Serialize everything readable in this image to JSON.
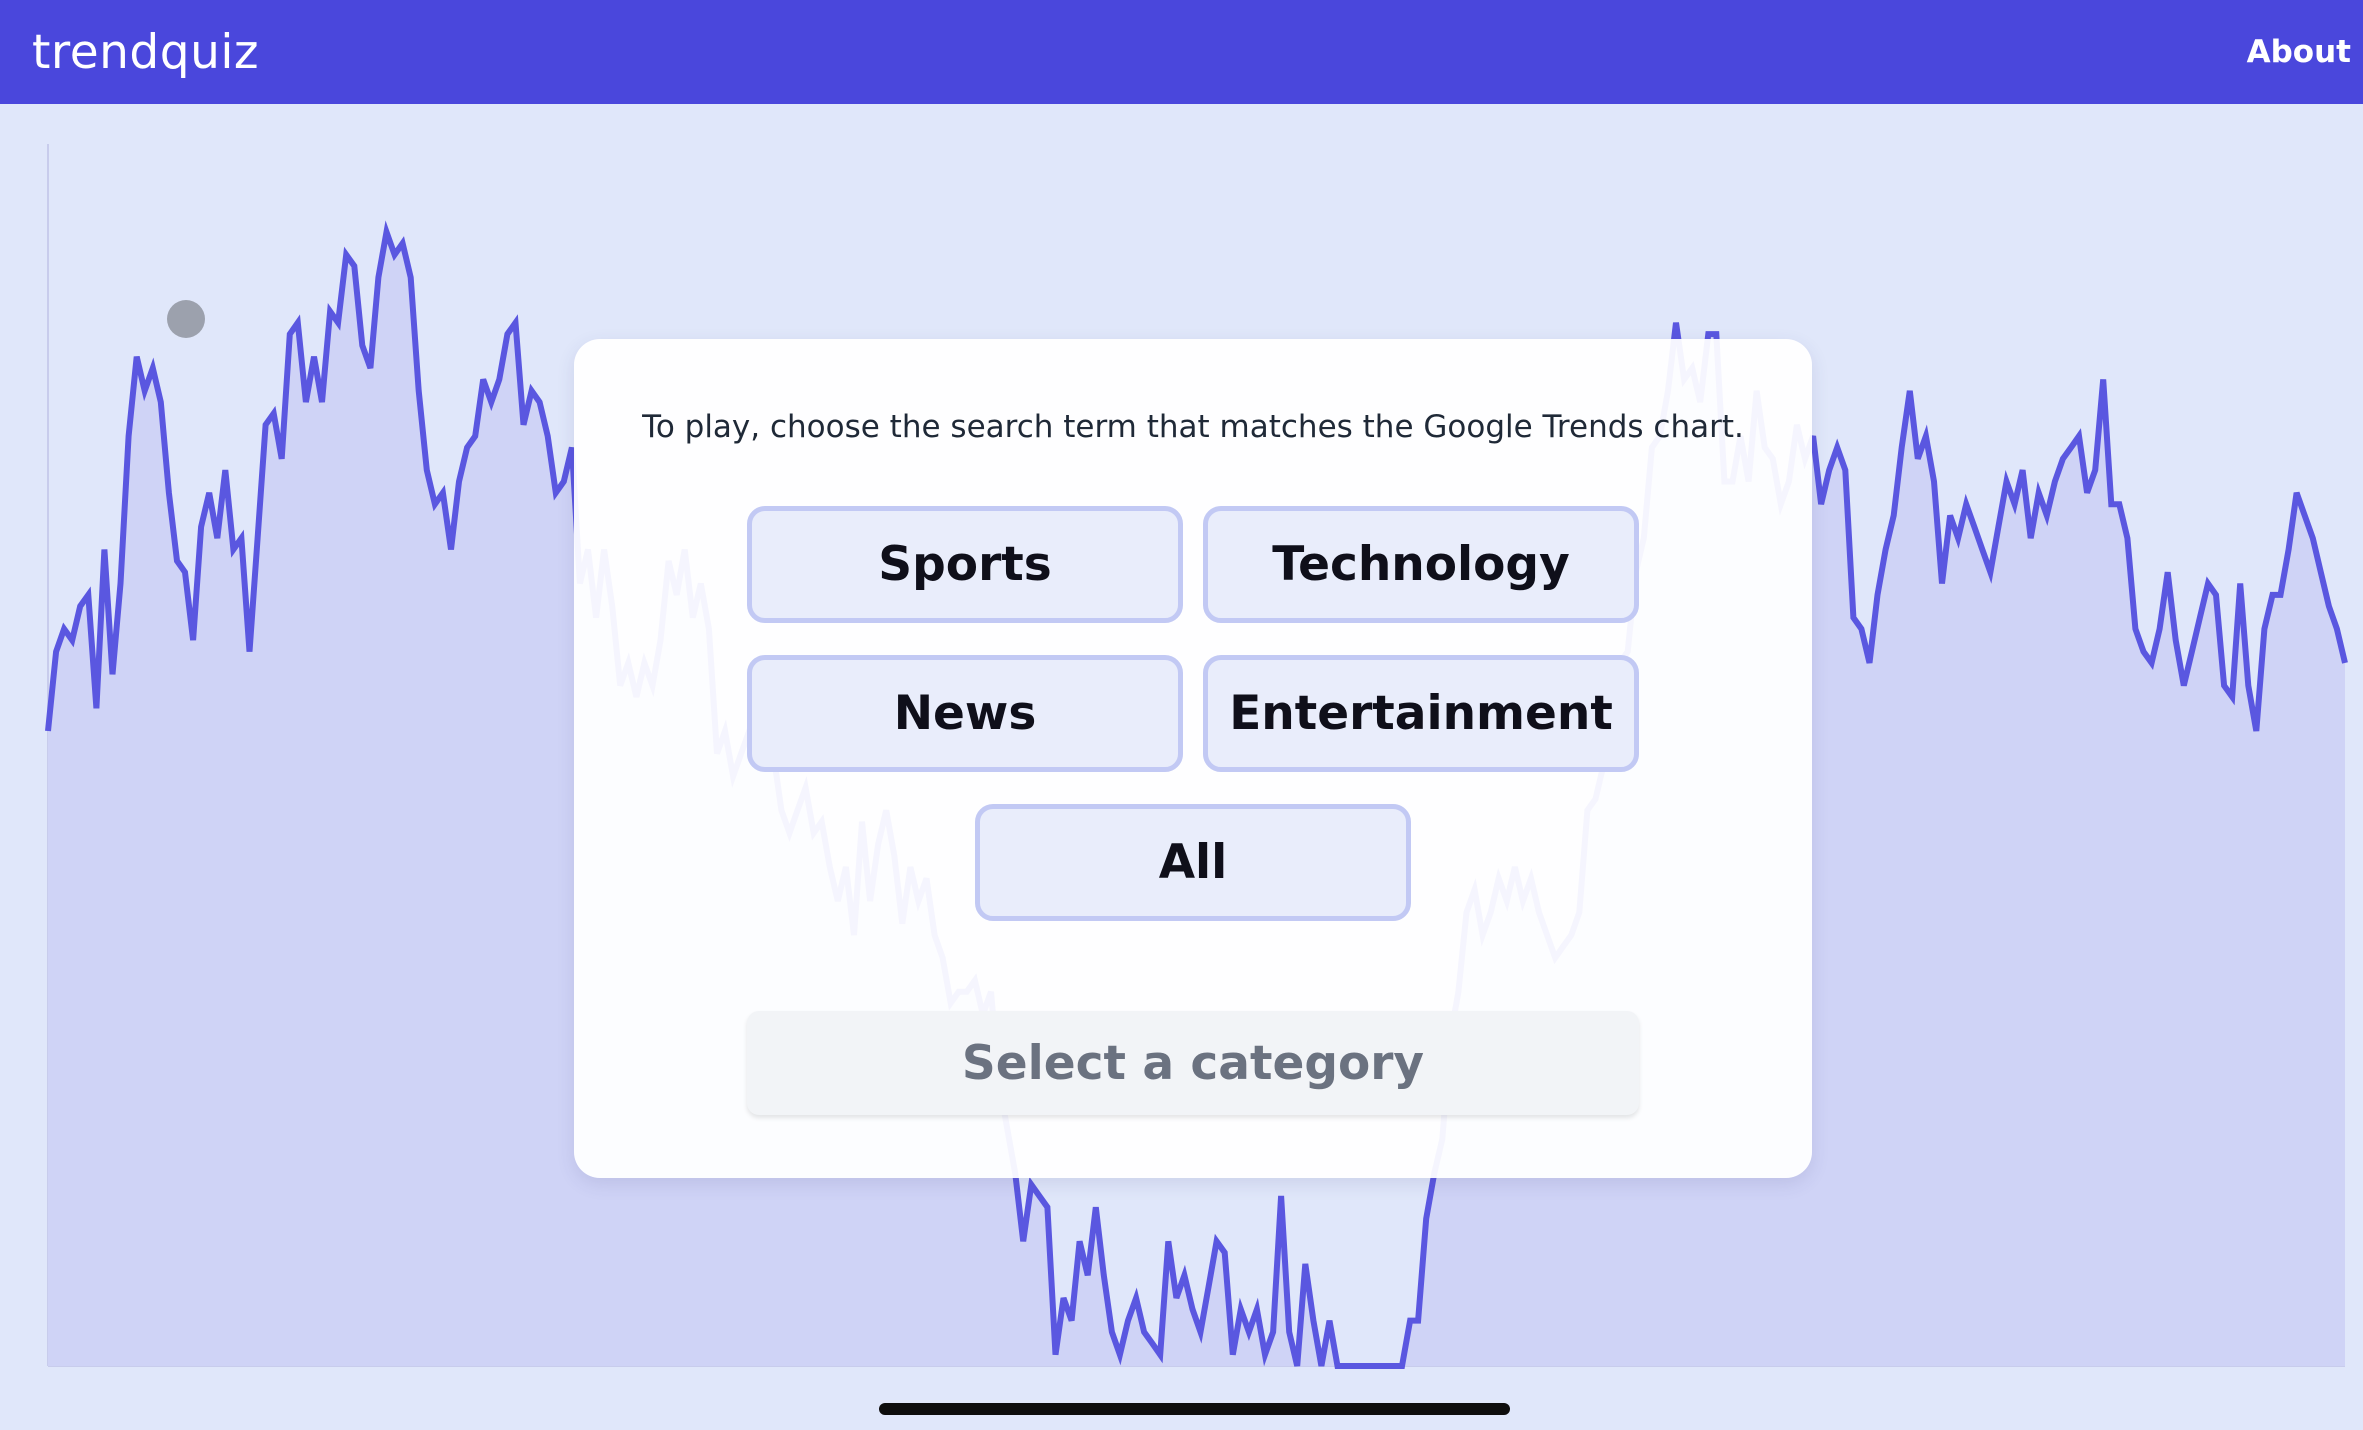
{
  "navbar": {
    "brand": "trendquiz",
    "about_label": "About"
  },
  "colors": {
    "nav_bg": "#4a47dc",
    "page_bg": "#e0e7fa",
    "line": "#5a57e0",
    "area_fill": "#cfd3f6",
    "button_bg": "#e9edfb",
    "button_border": "#c2c9f4",
    "submit_bg": "#f2f4f7",
    "submit_text": "#6b7280"
  },
  "quiz": {
    "instructions": "To play, choose the search term that matches the Google Trends chart.",
    "categories": [
      "Sports",
      "Technology",
      "News",
      "Entertainment",
      "All"
    ],
    "submit_label": "Select a category"
  },
  "chart_data": {
    "type": "area",
    "y": [
      56,
      63,
      65,
      64,
      67,
      68,
      58,
      72,
      61,
      69,
      82,
      89,
      86,
      88,
      85,
      77,
      71,
      70,
      64,
      74,
      77,
      73,
      79,
      72,
      73,
      63,
      73,
      83,
      84,
      80,
      91,
      92,
      85,
      89,
      85,
      93,
      92,
      98,
      97,
      90,
      88,
      96,
      100,
      98,
      99,
      96,
      86,
      79,
      76,
      77,
      72,
      78,
      81,
      82,
      87,
      85,
      87,
      91,
      92,
      83,
      86,
      85,
      82,
      77,
      78,
      81,
      69,
      72,
      66,
      72,
      67,
      60,
      62,
      59,
      62,
      60,
      64,
      71,
      68,
      72,
      66,
      69,
      65,
      54,
      56,
      52,
      54,
      56,
      55,
      54,
      54,
      49,
      47,
      49,
      51,
      47,
      48,
      44,
      41,
      44,
      38,
      48,
      41,
      46,
      49,
      45,
      39,
      44,
      41,
      43,
      38,
      36,
      32,
      33,
      33,
      34,
      31,
      33,
      25,
      21,
      17,
      11,
      16,
      15,
      14,
      1,
      6,
      4,
      11,
      8,
      14,
      8,
      3,
      1,
      4,
      6,
      3,
      2,
      1,
      11,
      6,
      8,
      5,
      3,
      7,
      11,
      10,
      1,
      5,
      3,
      5,
      1,
      3,
      15,
      3,
      0,
      9,
      4,
      0,
      4,
      0,
      0,
      0,
      0,
      0,
      0,
      0,
      0,
      0,
      4,
      4,
      13,
      17,
      20,
      29,
      33,
      40,
      42,
      38,
      40,
      43,
      41,
      44,
      41,
      43,
      40,
      38,
      36,
      37,
      38,
      40,
      49,
      50,
      53,
      58,
      62,
      63,
      70,
      73,
      81,
      82,
      86,
      92,
      87,
      88,
      85,
      91,
      91,
      78,
      78,
      82,
      78,
      86,
      81,
      80,
      76,
      78,
      83,
      80,
      82,
      76,
      79,
      81,
      79,
      66,
      65,
      62,
      68,
      72,
      75,
      81,
      86,
      80,
      82,
      78,
      69,
      75,
      73,
      76,
      74,
      72,
      70,
      74,
      78,
      76,
      79,
      73,
      77,
      75,
      78,
      80,
      81,
      82,
      77,
      79,
      87,
      76,
      76,
      73,
      65,
      63,
      62,
      65,
      70,
      64,
      60,
      63,
      66,
      69,
      68,
      60,
      59,
      69,
      60,
      56,
      65,
      68,
      68,
      72,
      77,
      75,
      73,
      70,
      67,
      65,
      62
    ]
  }
}
